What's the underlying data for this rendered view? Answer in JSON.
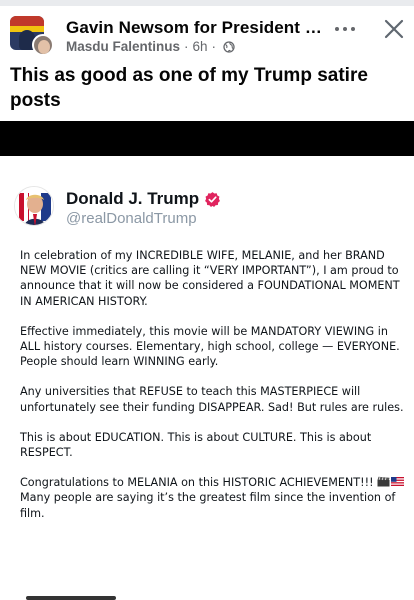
{
  "post": {
    "group_name": "Gavin Newsom for President 2...",
    "author": "Masdu Falentinus",
    "time": "6h",
    "separator": "·",
    "text": "This as good as one of my Trump satire posts"
  },
  "icons": {
    "more": "more-horizontal-icon",
    "close": "close-icon",
    "audience": "globe-icon",
    "verified": "verified-badge-icon"
  },
  "tweet": {
    "name": "Donald J. Trump",
    "handle": "@realDonaldTrump",
    "paragraphs": [
      "In celebration of my INCREDIBLE WIFE, MELANIE, and her BRAND NEW MOVIE (critics are calling it “VERY IMPORTANT”), I am proud to announce that it will now be considered a FOUNDATIONAL MOMENT IN AMERICAN HISTORY.",
      "Effective immediately, this movie will be MANDATORY VIEWING in ALL history courses. Elementary, high school, college — EVERYONE. People should learn WINNING early.",
      "Any universities that REFUSE to teach this MASTERPIECE will unfortunately see their funding DISAPPEAR. Sad! But rules are rules.",
      "This is about EDUCATION. This is about CULTURE. This is about RESPECT."
    ],
    "closing_line_1": "Congratulations to MELANIA on this HISTORIC ACHIEVEMENT!!!",
    "closing_line_2": "Many people are saying it’s the greatest film since the invention of film."
  },
  "colors": {
    "meta_gray": "#65676b",
    "verified_red": "#e0245e",
    "handle_gray": "#8b98a5"
  }
}
